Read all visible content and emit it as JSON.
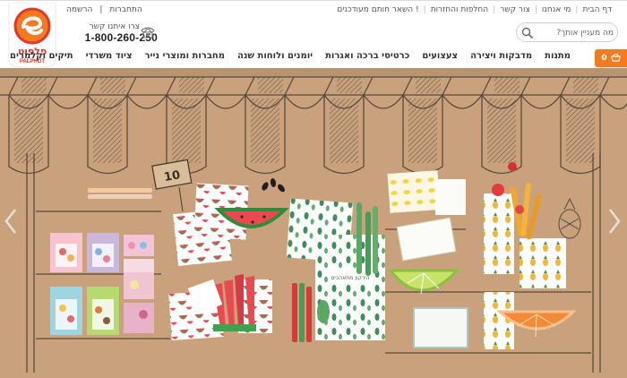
{
  "header": {
    "top_links": [
      "דף הבית",
      "מי אנחנו",
      "צור קשר",
      "החלפות והחזרות",
      "השאר חותם מעודכנים !"
    ],
    "auth": {
      "login": "התחברות",
      "register": "הרשמה",
      "sep": "|"
    },
    "contact": {
      "label": "צרו איתנו קשר",
      "phone": "1-800-260-250"
    },
    "search": {
      "placeholder": "מה מעניין אותך?"
    },
    "logo": {
      "text_he": "פלפוט",
      "text_en": "PALPHOT"
    },
    "cart": {
      "count": "0"
    }
  },
  "nav": {
    "items": [
      "מתנות",
      "מדבקות ויצירה",
      "צעצועים",
      "כרטיסי ברכה ואגרות",
      "יומנים ולוחות שנה",
      "מחברות ומוצרי נייר",
      "ציוד משרדי",
      "תיקים וקלמרים"
    ]
  },
  "banner": {
    "price_tag": "10",
    "notebook_text": "הירקון מתאהבים"
  },
  "colors": {
    "accent": "#f47a20",
    "kraft": "#c9a27d",
    "logo_red": "#e4352b"
  },
  "icons": [
    "phone-icon",
    "search-icon",
    "cart-icon",
    "chevron-left-icon",
    "chevron-right-icon"
  ]
}
